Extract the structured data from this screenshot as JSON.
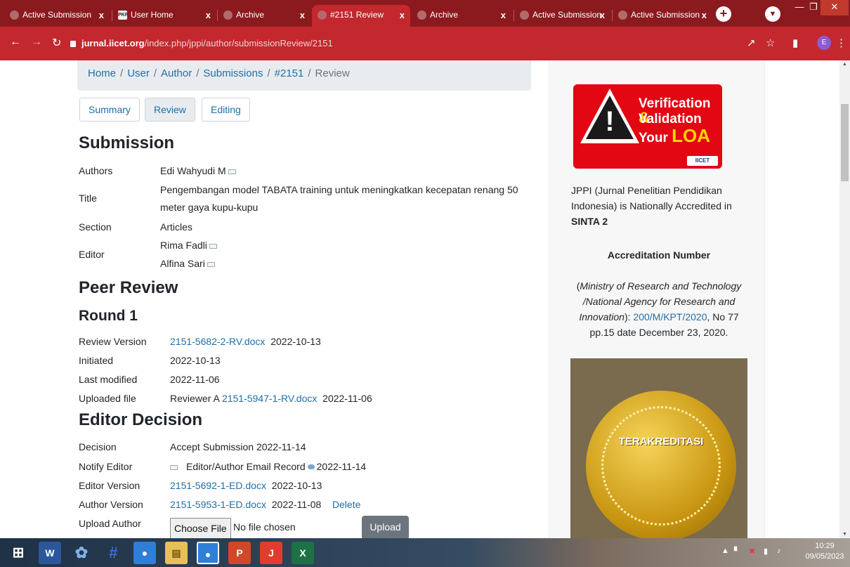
{
  "browser": {
    "tabs": [
      {
        "label": "Active Submission",
        "icon": "ojs-icon"
      },
      {
        "label": "User Home",
        "icon": "pkp-icon"
      },
      {
        "label": "Archive",
        "icon": "ojs-icon"
      },
      {
        "label": "#2151 Review",
        "icon": "ojs-icon"
      },
      {
        "label": "Archive",
        "icon": "ojs-icon"
      },
      {
        "label": "Active Submission",
        "icon": "ojs-icon"
      },
      {
        "label": "Active Submission",
        "icon": "ojs-icon"
      }
    ],
    "pkp_badge": "PKP",
    "new_tab": "+",
    "url_host": "jurnal.iicet.org",
    "url_path": "/index.php/jppi/author/submissionReview/2151",
    "profile_initial": "E",
    "close_glyph": "x"
  },
  "breadcrumb": {
    "items": [
      "Home",
      "User",
      "Author",
      "Submissions",
      "#2151"
    ],
    "current": "Review",
    "separator": "/"
  },
  "page_tabs": [
    "Summary",
    "Review",
    "Editing"
  ],
  "submission": {
    "heading": "Submission",
    "authors_label": "Authors",
    "authors": "Edi Wahyudi M",
    "title_label": "Title",
    "title_line1": "Pengembangan model TABATA training untuk meningkatkan kecepatan renang 50",
    "title_line2": "meter gaya kupu-kupu",
    "section_label": "Section",
    "section": "Articles",
    "editor_label": "Editor",
    "editors": [
      "Rima Fadli",
      "Alfina Sari"
    ]
  },
  "peer_review": {
    "heading": "Peer Review",
    "round": "Round 1",
    "review_version_label": "Review Version",
    "review_version_file": "2151-5682-2-RV.docx",
    "review_version_date": "2022-10-13",
    "initiated_label": "Initiated",
    "initiated": "2022-10-13",
    "last_modified_label": "Last modified",
    "last_modified": "2022-11-06",
    "uploaded_file_label": "Uploaded file",
    "uploaded_file_reviewer": "Reviewer A",
    "uploaded_file_name": "2151-5947-1-RV.docx",
    "uploaded_file_date": "2022-11-06"
  },
  "editor_decision": {
    "heading": "Editor Decision",
    "decision_label": "Decision",
    "decision": "Accept Submission 2022-11-14",
    "notify_label": "Notify Editor",
    "notify_record": "Editor/Author Email Record",
    "notify_date": "2022-11-14",
    "editor_version_label": "Editor Version",
    "editor_version_file": "2151-5692-1-ED.docx",
    "editor_version_date": "2022-10-13",
    "author_version_label": "Author Version",
    "author_version_file": "2151-5953-1-ED.docx",
    "author_version_date": "2022-11-08",
    "delete_label": "Delete",
    "upload_author_label": "Upload Author",
    "choose_file_label": "Choose File",
    "no_file_label": "No file chosen",
    "upload_button": "Upload"
  },
  "sidebar": {
    "banner_line1": "Verification",
    "banner_amp": "&",
    "banner_line2": "Validation",
    "banner_line3_prefix": "Your",
    "banner_loa": "LOA",
    "banner_logo": "IICET",
    "accredited_text": "JPPI (Jurnal Penelitian Pendidikan Indonesia) is Nationally Accredited in",
    "accredited_rank": "SINTA 2",
    "accreditation_heading": "Accreditation Number",
    "ministry_open": "(",
    "ministry_text": "Ministry of Research and Technology /National Agency for Research and Innovation",
    "ministry_close": "): ",
    "decree_link": "200/M/KPT/2020",
    "decree_rest": ", No 77 pp.15 date December 23, 2020.",
    "seal_text": "TERAKREDITASI"
  },
  "taskbar": {
    "clock_time": "10:29",
    "clock_date": "09/05/2023"
  }
}
